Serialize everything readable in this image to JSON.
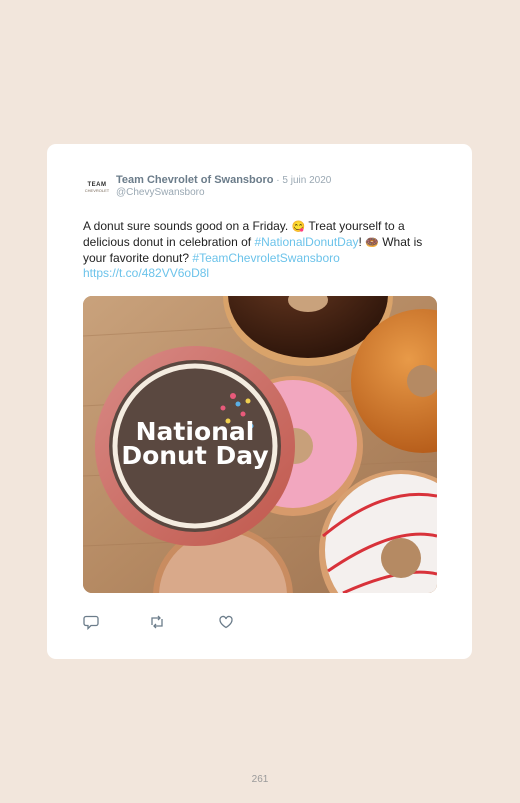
{
  "tweet": {
    "author_name": "Team Chevrolet of Swansboro",
    "separator": " · ",
    "date": "5 juin 2020",
    "handle": "@ChevySwansboro",
    "avatar_text_top": "TEAM",
    "avatar_text_bottom": "CHEVROLET",
    "text_part1": "A donut sure sounds good on a Friday. ",
    "emoji1": "😋",
    "text_part2": " Treat yourself to a delicious donut in celebration of ",
    "hashtag1": "#NationalDonutDay",
    "text_part3": "! ",
    "emoji2": "🍩",
    "text_part4": " What is your favorite donut? ",
    "hashtag2": "#TeamChevroletSwansboro",
    "short_link": "https://t.co/482VV6oD8l"
  },
  "media": {
    "badge_line1": "National",
    "badge_line2": "Donut Day"
  },
  "actions": {
    "reply_icon": "reply-icon",
    "retweet_icon": "retweet-icon",
    "like_icon": "heart-icon"
  },
  "page": {
    "number": "261"
  },
  "colors": {
    "background": "#f2e6dc",
    "link": "#6cc3ea",
    "name": "#6b7c8a",
    "meta": "#9aa8b3"
  }
}
